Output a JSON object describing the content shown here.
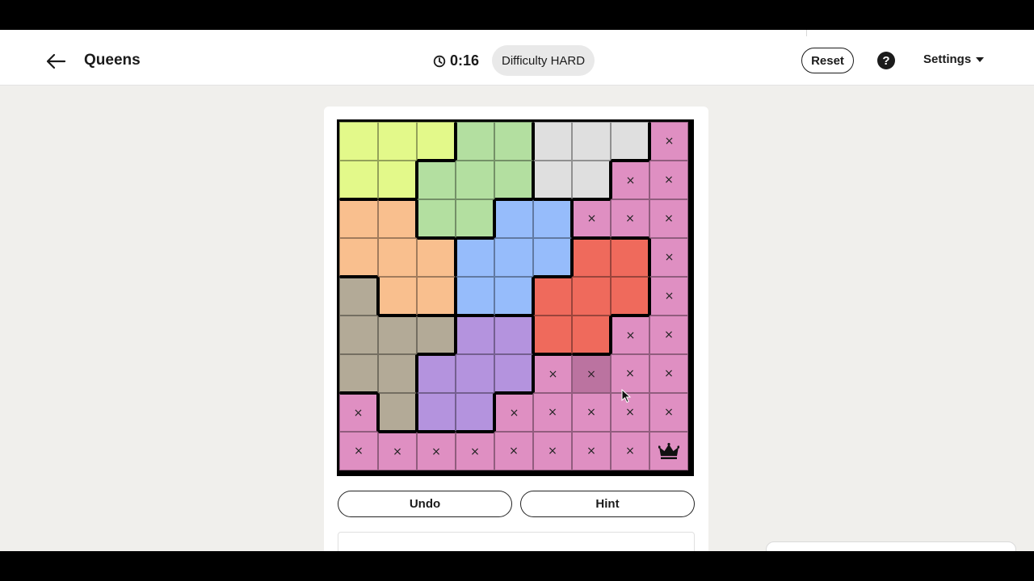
{
  "header": {
    "back_icon": "arrow-left-icon",
    "title": "Queens",
    "timer": "0:16",
    "timer_icon": "clock-icon",
    "difficulty_label": "Difficulty",
    "difficulty_value": "HARD",
    "reset_label": "Reset",
    "help_label": "?",
    "settings_label": "Settings"
  },
  "board": {
    "size": 9,
    "colors": {
      "Y": "#e3f98a",
      "G": "#b3dfa0",
      "W": "#dfdfdf",
      "P": "#df8fc2",
      "O": "#f9bf8e",
      "B": "#96bcfb",
      "R": "#ef6a5c",
      "T": "#b3aa97",
      "V": "#b493de"
    },
    "regions": [
      [
        "Y",
        "Y",
        "Y",
        "G",
        "G",
        "W",
        "W",
        "W",
        "P"
      ],
      [
        "Y",
        "Y",
        "G",
        "G",
        "G",
        "W",
        "W",
        "P",
        "P"
      ],
      [
        "O",
        "O",
        "G",
        "G",
        "B",
        "B",
        "P",
        "P",
        "P"
      ],
      [
        "O",
        "O",
        "O",
        "B",
        "B",
        "B",
        "R",
        "R",
        "P"
      ],
      [
        "T",
        "O",
        "O",
        "B",
        "B",
        "R",
        "R",
        "R",
        "P"
      ],
      [
        "T",
        "T",
        "T",
        "V",
        "V",
        "R",
        "R",
        "P",
        "P"
      ],
      [
        "T",
        "T",
        "V",
        "V",
        "V",
        "P",
        "P",
        "P",
        "P"
      ],
      [
        "P",
        "T",
        "V",
        "V",
        "P",
        "P",
        "P",
        "P",
        "P"
      ],
      [
        "P",
        "P",
        "P",
        "P",
        "P",
        "P",
        "P",
        "P",
        "P"
      ]
    ],
    "marks": [
      [
        "",
        "",
        "",
        "",
        "",
        "",
        "",
        "",
        "x"
      ],
      [
        "",
        "",
        "",
        "",
        "",
        "",
        "",
        "x",
        "x"
      ],
      [
        "",
        "",
        "",
        "",
        "",
        "",
        "x",
        "x",
        "x"
      ],
      [
        "",
        "",
        "",
        "",
        "",
        "",
        "",
        "",
        "x"
      ],
      [
        "",
        "",
        "",
        "",
        "",
        "",
        "",
        "",
        "x"
      ],
      [
        "",
        "",
        "",
        "",
        "",
        "",
        "",
        "x",
        "x"
      ],
      [
        "",
        "",
        "",
        "",
        "",
        "x",
        "x",
        "x",
        "x"
      ],
      [
        "x",
        "",
        "",
        "",
        "x",
        "x",
        "x",
        "x",
        "x"
      ],
      [
        "x",
        "x",
        "x",
        "x",
        "x",
        "x",
        "x",
        "x",
        "Q"
      ]
    ],
    "hover_cell": [
      6,
      6
    ],
    "mark_symbol": "×"
  },
  "actions": {
    "undo_label": "Undo",
    "hint_label": "Hint"
  }
}
